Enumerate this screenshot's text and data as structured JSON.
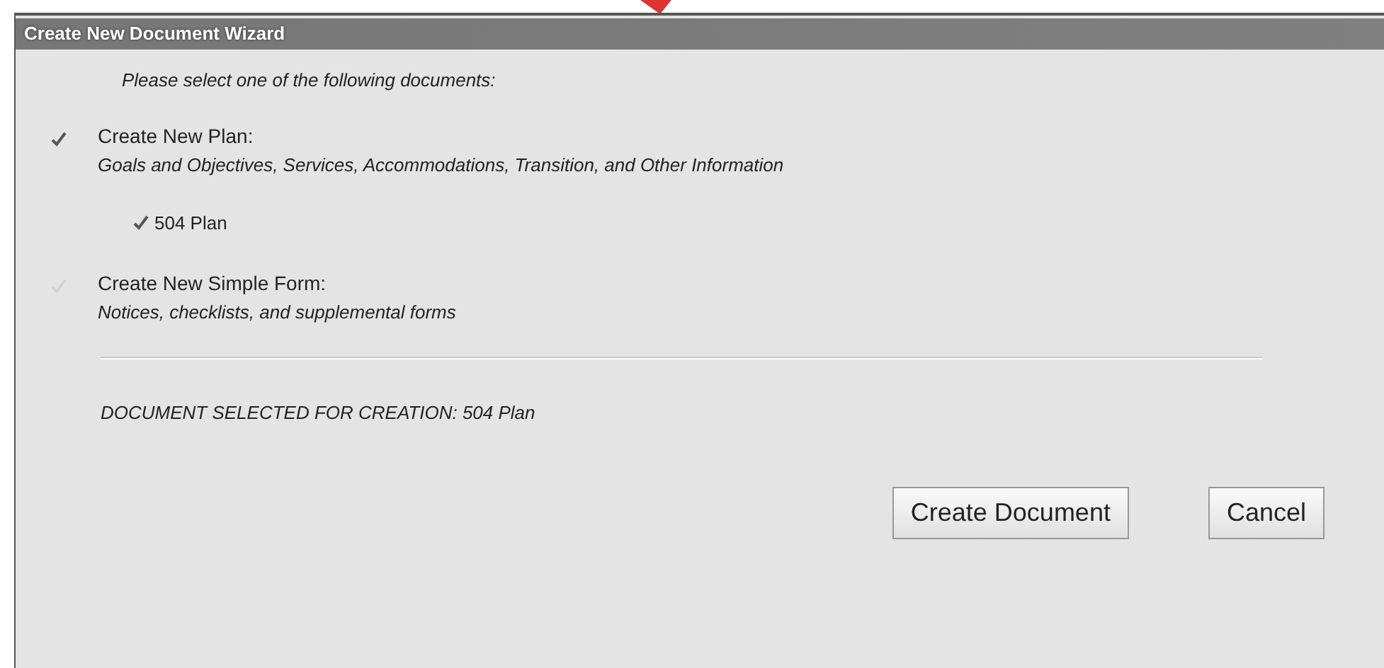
{
  "window": {
    "title": "Create New Document Wizard"
  },
  "prompt": "Please select one of the following documents:",
  "options": [
    {
      "title": "Create New Plan:",
      "description": "Goals and Objectives, Services, Accommodations, Transition, and Other Information",
      "selected": true,
      "children": [
        {
          "label": "504 Plan",
          "selected": true
        }
      ]
    },
    {
      "title": "Create New Simple Form:",
      "description": "Notices, checklists, and supplemental forms",
      "selected": false
    }
  ],
  "selection": "DOCUMENT SELECTED FOR CREATION: 504 Plan",
  "buttons": [
    "Create Document",
    "Cancel"
  ]
}
